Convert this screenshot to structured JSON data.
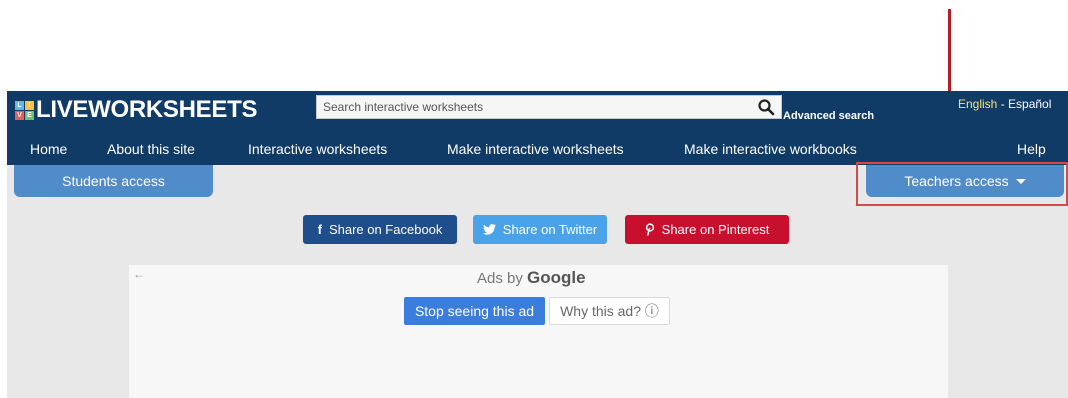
{
  "site": {
    "logo": {
      "text": "LIVEWORKSHEETS",
      "grid_letters": [
        "L",
        "I",
        "V",
        "E"
      ],
      "grid_colors": [
        "#5fb8e8",
        "#f5c542",
        "#e85c5c",
        "#6cc36c"
      ]
    },
    "search": {
      "placeholder": "Search interactive worksheets",
      "icon": "magnifier-icon",
      "advanced_label": "Advanced search"
    },
    "languages": {
      "english": "English",
      "separator": " - ",
      "spanish": "Español"
    },
    "nav": [
      {
        "label": "Home"
      },
      {
        "label": "About this site"
      },
      {
        "label": "Interactive worksheets"
      },
      {
        "label": "Make interactive worksheets"
      },
      {
        "label": "Make interactive workbooks"
      },
      {
        "label": "Help"
      }
    ],
    "students_access": "Students access",
    "teachers_access": "Teachers access",
    "share": {
      "facebook": {
        "icon": "f",
        "label": "Share on Facebook"
      },
      "twitter": {
        "icon": "twitter-bird-icon",
        "label": "Share on Twitter"
      },
      "pinterest": {
        "icon": "pinterest-icon",
        "label": "Share on Pinterest"
      }
    },
    "ad": {
      "back_icon": "←",
      "ads_by": "Ads by",
      "google": "Google",
      "stop_label": "Stop seeing this ad",
      "why_label": "Why this ad? ⓘ"
    }
  },
  "colors": {
    "header_bg": "#0f3b66",
    "access_bg": "#4f8cc9",
    "annotation_red": "#b01e2a",
    "facebook": "#1f4e8c",
    "twitter": "#4aa3e8",
    "pinterest": "#c8102e"
  }
}
